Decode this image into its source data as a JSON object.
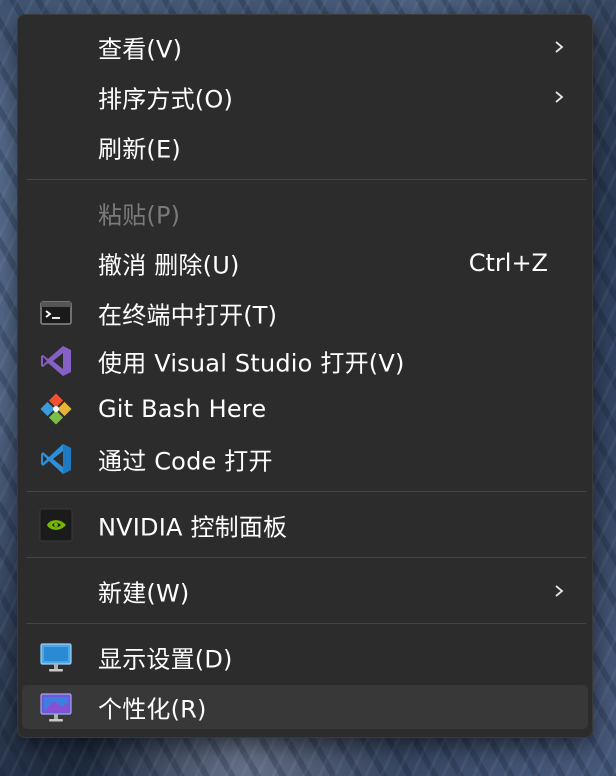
{
  "menu": {
    "items": {
      "view": {
        "label": "查看(V)",
        "icon": "none",
        "submenu": true
      },
      "sort": {
        "label": "排序方式(O)",
        "icon": "none",
        "submenu": true
      },
      "refresh": {
        "label": "刷新(E)",
        "icon": "none"
      },
      "paste": {
        "label": "粘贴(P)",
        "icon": "none",
        "disabled": true
      },
      "undo": {
        "label": "撤消 删除(U)",
        "shortcut": "Ctrl+Z",
        "icon": "none"
      },
      "terminal": {
        "label": "在终端中打开(T)",
        "icon": "terminal-icon"
      },
      "visual_studio": {
        "label": "使用 Visual Studio 打开(V)",
        "icon": "visual-studio-icon"
      },
      "git_bash": {
        "label": "Git Bash Here",
        "icon": "git-icon"
      },
      "vscode": {
        "label": "通过 Code 打开",
        "icon": "vscode-icon"
      },
      "nvidia": {
        "label": "NVIDIA 控制面板",
        "icon": "nvidia-icon"
      },
      "new": {
        "label": "新建(W)",
        "icon": "none",
        "submenu": true
      },
      "display": {
        "label": "显示设置(D)",
        "icon": "display-icon"
      },
      "personalize": {
        "label": "个性化(R)",
        "icon": "personalize-icon",
        "hovered": true
      }
    }
  },
  "colors": {
    "menu_bg": "#2c2c2c",
    "hover_bg": "#383838",
    "text": "#ffffff",
    "disabled_text": "#7a7a7a",
    "separator": "#454545"
  }
}
